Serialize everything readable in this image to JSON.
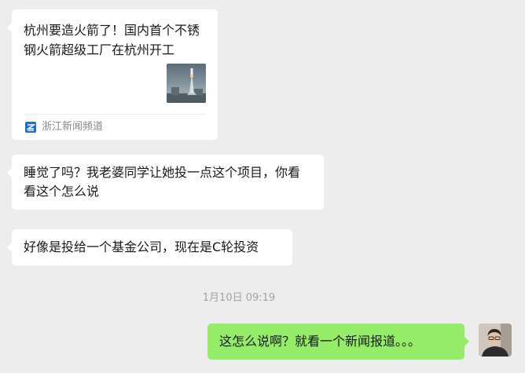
{
  "messages": {
    "card": {
      "title": "杭州要造火箭了！国内首个不锈钢火箭超级工厂在杭州开工",
      "source": "浙江新闻频道"
    },
    "msg2": "睡觉了吗？我老婆同学让她投一点这个项目，你看看这个怎么说",
    "msg3": "好像是投给一个基金公司，现在是C轮投资",
    "timestamp": "1月10日 09:19",
    "msg4": "这怎么说啊？就看一个新闻报道。。。"
  },
  "colors": {
    "background": "#ededed",
    "incoming_bubble": "#ffffff",
    "outgoing_bubble": "#95ec69",
    "source_icon": "#1f6fd0"
  },
  "icons": {
    "source": "zhejiang-news-logo-icon",
    "thumbnail": "rocket-launch-thumbnail",
    "avatar": "user-avatar-photo"
  }
}
